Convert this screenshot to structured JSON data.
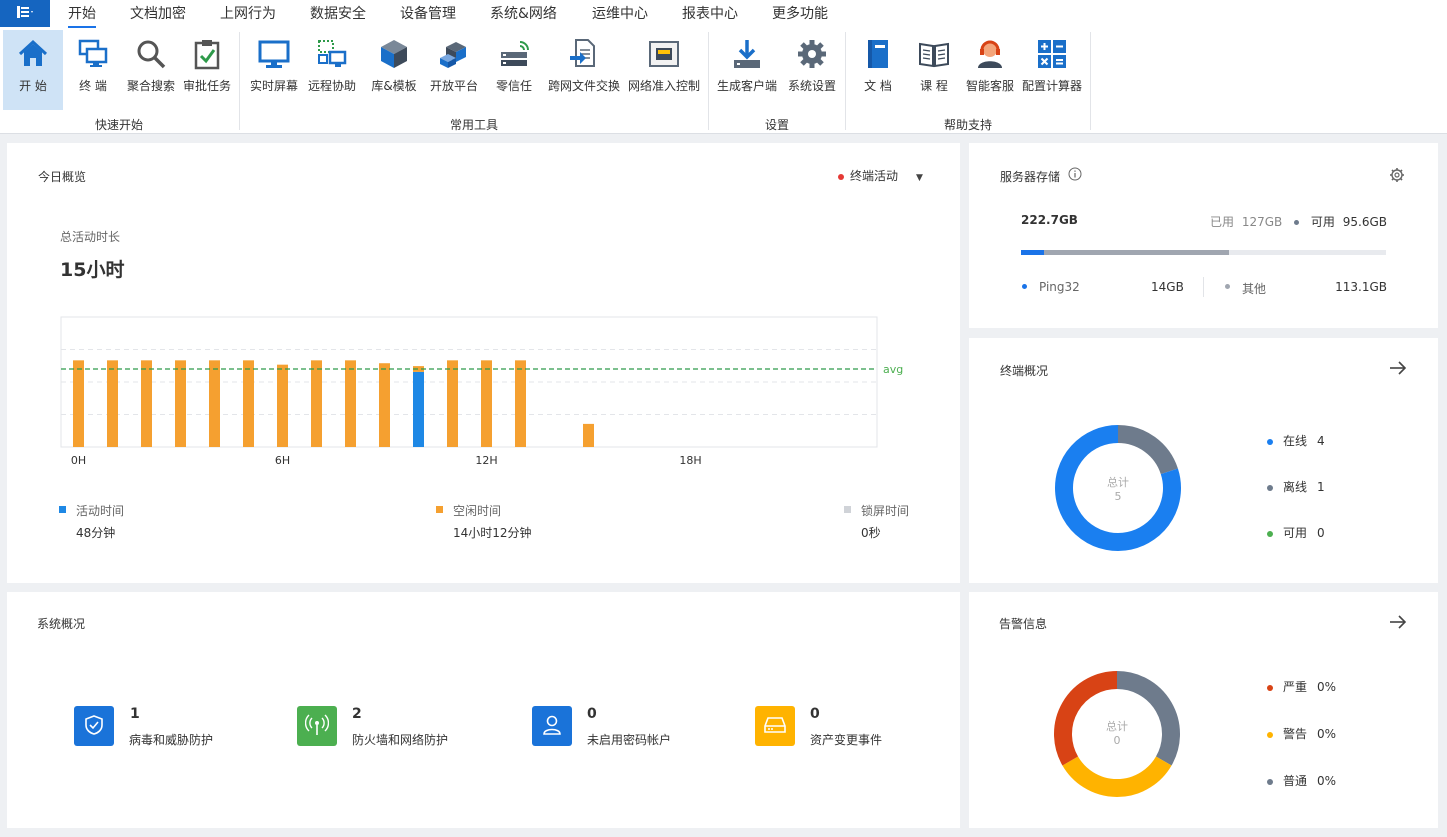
{
  "menubar": {
    "app_menu_icon": "document-list-icon",
    "tabs": [
      {
        "label": "开始",
        "active": true
      },
      {
        "label": "文档加密"
      },
      {
        "label": "上网行为"
      },
      {
        "label": "数据安全"
      },
      {
        "label": "设备管理"
      },
      {
        "label": "系统&网络"
      },
      {
        "label": "运维中心"
      },
      {
        "label": "报表中心"
      },
      {
        "label": "更多功能"
      }
    ]
  },
  "ribbon": {
    "groups": [
      {
        "label": "快速开始"
      },
      {
        "label": "常用工具"
      },
      {
        "label": "设置"
      },
      {
        "label": "帮助支持"
      }
    ],
    "buttons": [
      {
        "label": "开 始",
        "icon": "home-icon"
      },
      {
        "label": "终 端",
        "icon": "terminal-monitors-icon"
      },
      {
        "label": "聚合搜索",
        "icon": "search-icon"
      },
      {
        "label": "审批任务",
        "icon": "clipboard-check-icon"
      },
      {
        "label": "实时屏幕",
        "icon": "monitor-icon"
      },
      {
        "label": "远程协助",
        "icon": "remote-assist-icon"
      },
      {
        "label": "库&模板",
        "icon": "cube-icon"
      },
      {
        "label": "开放平台",
        "icon": "blocks-icon"
      },
      {
        "label": "零信任",
        "icon": "zero-trust-icon"
      },
      {
        "label": "跨网文件交换",
        "icon": "file-exchange-icon"
      },
      {
        "label": "网络准入控制",
        "icon": "network-port-icon"
      },
      {
        "label": "生成客户端",
        "icon": "download-icon"
      },
      {
        "label": "系统设置",
        "icon": "gear-icon"
      },
      {
        "label": "文 档",
        "icon": "book-icon"
      },
      {
        "label": "课 程",
        "icon": "open-book-icon"
      },
      {
        "label": "智能客服",
        "icon": "support-agent-icon"
      },
      {
        "label": "配置计算器",
        "icon": "calculator-icon"
      }
    ]
  },
  "today": {
    "title": "今日概览",
    "filter_label": "终端活动",
    "total_label": "总活动时长",
    "total_value": "15小时",
    "avg_label": "avg",
    "legend": [
      {
        "label": "活动时间",
        "value": "48分钟",
        "color": "#1e88e5"
      },
      {
        "label": "空闲时间",
        "value": "14小时12分钟",
        "color": "#f5a030"
      },
      {
        "label": "锁屏时间",
        "value": "0秒",
        "color": "#d0d3d8"
      }
    ]
  },
  "chart_data": {
    "type": "bar",
    "stacked": true,
    "x_tick_labels": [
      "0H",
      "6H",
      "12H",
      "18H"
    ],
    "categories": [
      "0",
      "1",
      "2",
      "3",
      "4",
      "5",
      "6",
      "7",
      "8",
      "9",
      "10",
      "11",
      "12",
      "13",
      "14",
      "15",
      "16",
      "17",
      "18",
      "19",
      "20",
      "21",
      "22",
      "23"
    ],
    "series": [
      {
        "name": "活动时间",
        "color": "#1e88e5",
        "values": [
          0,
          0,
          0,
          0,
          0,
          0,
          0,
          0,
          0,
          0,
          52,
          0,
          0,
          0,
          0,
          0,
          0,
          0,
          0,
          0,
          0,
          0,
          0,
          0
        ]
      },
      {
        "name": "空闲时间",
        "color": "#f5a030",
        "values": [
          60,
          60,
          60,
          60,
          60,
          60,
          57,
          60,
          60,
          58,
          4,
          60,
          60,
          60,
          0,
          16,
          0,
          0,
          0,
          0,
          0,
          0,
          0,
          0
        ]
      }
    ],
    "avg": 54,
    "ylim": [
      0,
      90
    ],
    "grid": true
  },
  "storage": {
    "title": "服务器存储",
    "info_icon": "info-icon",
    "settings_icon": "gear-icon",
    "total": "222.7GB",
    "used_label": "已用",
    "used_value": "127GB",
    "free_label": "可用",
    "free_value": "95.6GB",
    "used_fraction": 0.57,
    "ping32_fraction": 0.063,
    "items": [
      {
        "name": "Ping32",
        "value": "14GB",
        "color": "#1a73e8"
      },
      {
        "name": "其他",
        "value": "113.1GB",
        "color": "#a0a6b0"
      }
    ]
  },
  "terminals": {
    "title": "终端概况",
    "total_label": "总计",
    "total_value": "5",
    "items": [
      {
        "label": "在线",
        "value": "4",
        "color": "#1a7ff0",
        "count": 4
      },
      {
        "label": "离线",
        "value": "1",
        "color": "#6e7b8c",
        "count": 1
      },
      {
        "label": "可用",
        "value": "0",
        "color": "#4caf50",
        "count": 0
      }
    ]
  },
  "system": {
    "title": "系统概况",
    "items": [
      {
        "value": "1",
        "label": "病毒和威胁防护",
        "color": "#1a73d9",
        "icon": "shield-icon"
      },
      {
        "value": "2",
        "label": "防火墙和网络防护",
        "color": "#4caf50",
        "icon": "antenna-icon"
      },
      {
        "value": "0",
        "label": "未启用密码帐户",
        "color": "#1a73d9",
        "icon": "user-icon"
      },
      {
        "value": "0",
        "label": "资产变更事件",
        "color": "#ffb300",
        "icon": "hard-drive-icon"
      }
    ]
  },
  "alerts": {
    "title": "告警信息",
    "total_label": "总计",
    "total_value": "0",
    "items": [
      {
        "label": "严重",
        "value": "0%",
        "color": "#d84315"
      },
      {
        "label": "警告",
        "value": "0%",
        "color": "#ffb300"
      },
      {
        "label": "普通",
        "value": "0%",
        "color": "#6e7b8c"
      }
    ]
  }
}
